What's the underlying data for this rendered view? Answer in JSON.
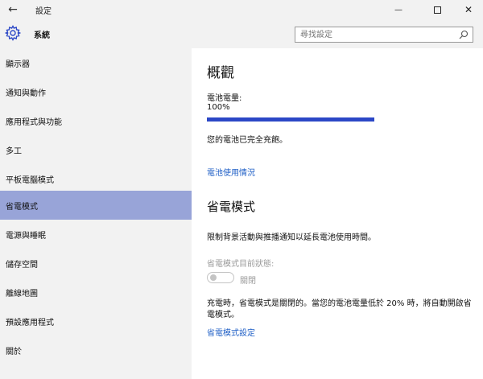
{
  "window": {
    "title": "設定",
    "back_symbol": "←",
    "minimize_symbol": "—",
    "close_symbol": "✕"
  },
  "header": {
    "section_title": "系統",
    "search_placeholder": "尋找設定"
  },
  "sidebar": {
    "items": [
      {
        "label": "顯示器",
        "selected": false
      },
      {
        "label": "通知與動作",
        "selected": false
      },
      {
        "label": "應用程式與功能",
        "selected": false
      },
      {
        "label": "多工",
        "selected": false
      },
      {
        "label": "平板電腦模式",
        "selected": false
      },
      {
        "label": "省電模式",
        "selected": true
      },
      {
        "label": "電源與睡眠",
        "selected": false
      },
      {
        "label": "儲存空間",
        "selected": false
      },
      {
        "label": "離線地圖",
        "selected": false
      },
      {
        "label": "預設應用程式",
        "selected": false
      },
      {
        "label": "關於",
        "selected": false
      }
    ]
  },
  "main": {
    "overview_title": "概觀",
    "battery_label": "電池電量:",
    "battery_percent_text": "100%",
    "battery_level": 1.0,
    "battery_status": "您的電池已完全充飽。",
    "battery_usage_link": "電池使用情況",
    "saver_title": "省電模式",
    "saver_description": "限制背景活動與推播通知以延長電池使用時間。",
    "saver_status_label": "省電模式目前狀態:",
    "toggle_state": "關閉",
    "charging_note": "充電時，省電模式是關閉的。當您的電池電量低於 20% 時，將自動開啟省電模式。",
    "saver_settings_link": "省電模式設定"
  },
  "colors": {
    "accent": "#2b47c6",
    "selected_nav": "#98a4d8",
    "link": "#1f5fc6",
    "chrome_bg": "#f2f2f2"
  }
}
